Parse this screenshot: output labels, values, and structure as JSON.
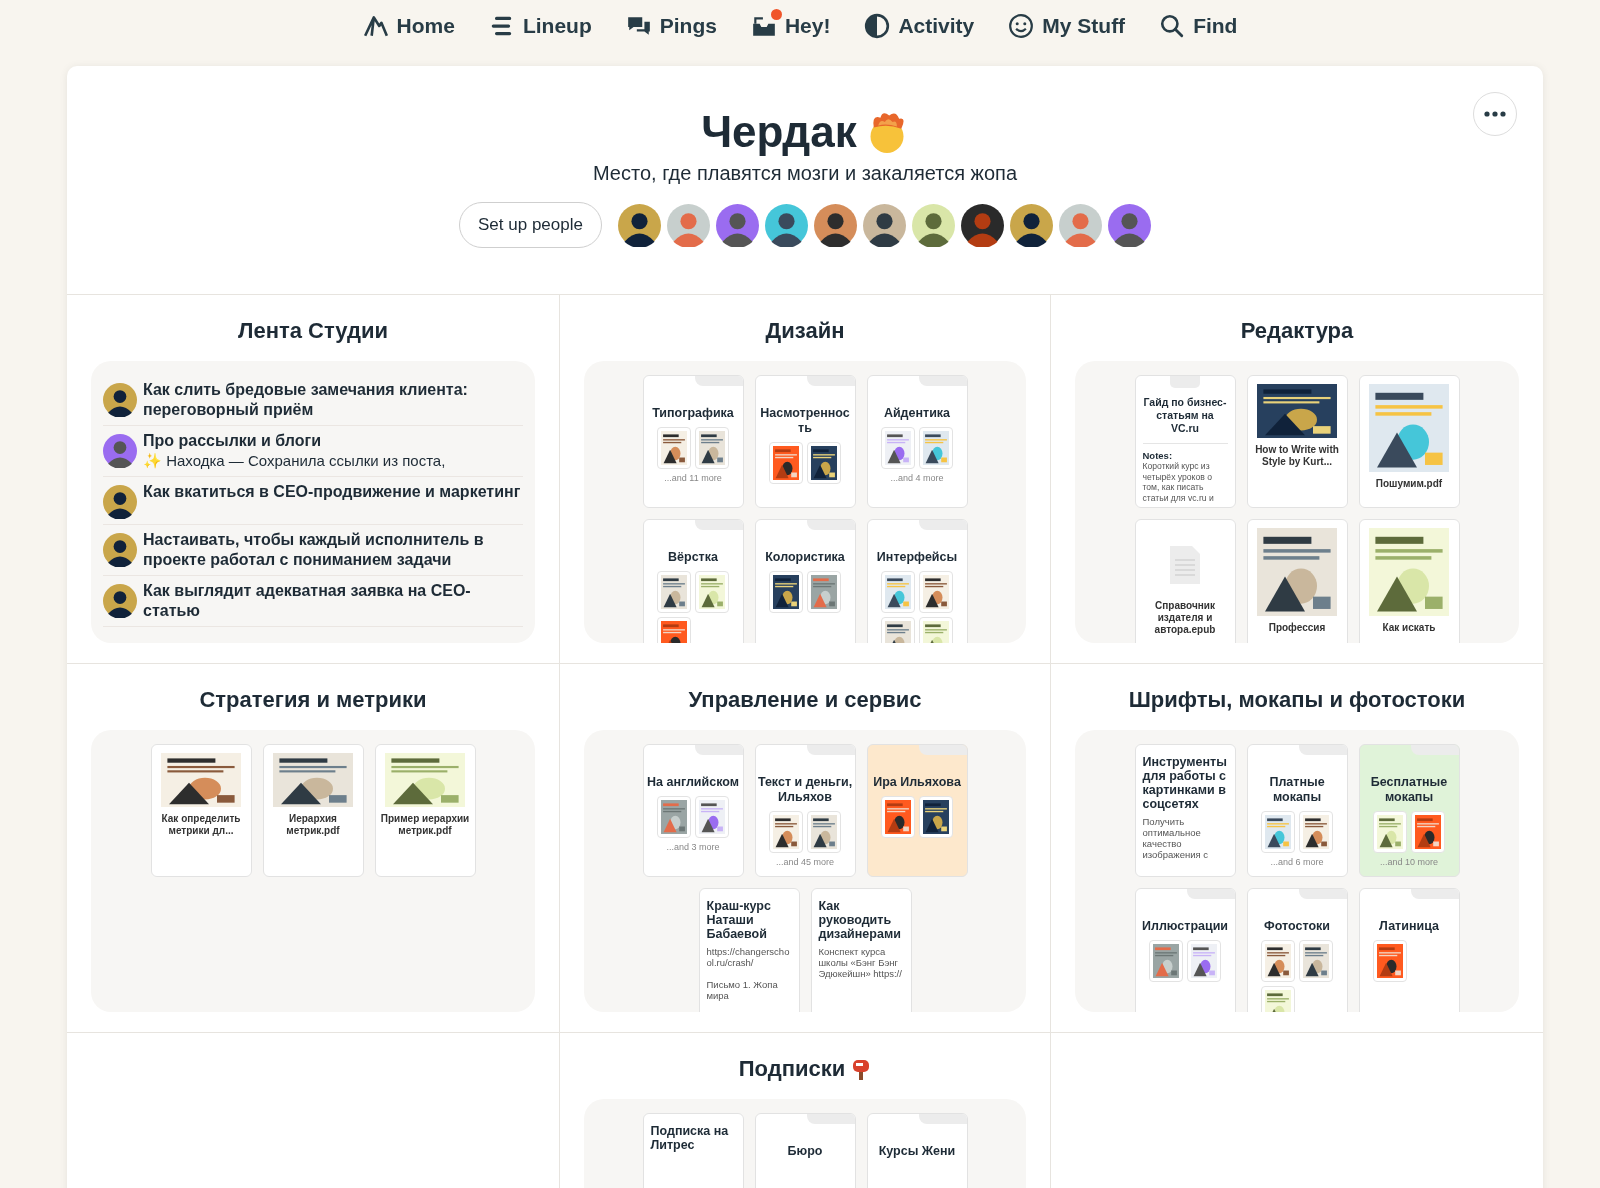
{
  "nav": [
    {
      "kind": "home",
      "label": "Home"
    },
    {
      "kind": "lineup",
      "label": "Lineup"
    },
    {
      "kind": "pings",
      "label": "Pings"
    },
    {
      "kind": "hey",
      "label": "Hey!",
      "badge": true
    },
    {
      "kind": "activity",
      "label": "Activity"
    },
    {
      "kind": "mystuff",
      "label": "My Stuff"
    },
    {
      "kind": "find",
      "label": "Find"
    }
  ],
  "project": {
    "title": "Чердак",
    "title_icon": true,
    "subtitle": "Место, где плавятся мозги и закаляется жопа",
    "people_button": "Set up people"
  },
  "tools": [
    {
      "kind": "messages",
      "title": "Лента Студии",
      "messages": [
        {
          "title": "Как слить бредовые замечания клиента: переговорный приём"
        },
        {
          "title": "Про рассылки и блоги",
          "excerpt": "✨ Находка — Сохранила ссылки из поста,"
        },
        {
          "title": "Как вкатиться в СЕО-продвижение и маркетинг"
        },
        {
          "title": "Настаивать, чтобы каждый исполнитель в проекте работал с пониманием задачи"
        },
        {
          "title": "Как выглядит адекватная заявка на СЕО-статью"
        }
      ]
    },
    {
      "kind": "tiles",
      "title": "Дизайн",
      "tiles": [
        {
          "kind": "folder",
          "title": "Типографика",
          "color": "#ffffff",
          "more": "...and 11 more"
        },
        {
          "kind": "folder",
          "title": "Насмотренность",
          "color": "#ffffff"
        },
        {
          "kind": "folder",
          "title": "Айдентика",
          "color": "#ffffff",
          "more": "...and 4 more"
        },
        {
          "kind": "folder",
          "title": "Вёрстка",
          "color": "#ffffff"
        },
        {
          "kind": "folder",
          "title": "Колористика",
          "color": "#ffffff"
        },
        {
          "kind": "folder",
          "title": "Интерфейсы",
          "color": "#ffffff"
        }
      ]
    },
    {
      "kind": "tiles",
      "title": "Редактура",
      "tiles": [
        {
          "kind": "note",
          "title": "Гайд по бизнес-статьям на VC.ru",
          "notes_label": "Notes:",
          "notes": "Короткий курс из четырёх уроков о том, как писать статьи для vc.ru и"
        },
        {
          "kind": "file",
          "title": "How to Write with Style by Kurt..."
        },
        {
          "kind": "file",
          "title": "Пошумим.pdf",
          "preview": {
            "kind": "cover"
          }
        },
        {
          "kind": "file",
          "title": "Справочник издателя и автора.epub",
          "preview": {
            "kind": "document"
          }
        },
        {
          "kind": "file",
          "title": "Профессия",
          "preview": {
            "kind": "cover"
          }
        },
        {
          "kind": "file",
          "title": "Как искать",
          "preview": {
            "kind": "cover"
          }
        }
      ]
    },
    {
      "kind": "tiles",
      "title": "Стратегия и метрики",
      "tiles": [
        {
          "kind": "file",
          "title": "Как определить метрики дл..."
        },
        {
          "kind": "file",
          "title": "Иерархия метрик.pdf"
        },
        {
          "kind": "file",
          "title": "Пример иерархии метрик.pdf"
        }
      ]
    },
    {
      "kind": "tiles",
      "title": "Управление и сервис",
      "tiles": [
        {
          "kind": "folder",
          "title": "На английском",
          "color": "#ffffff",
          "more": "...and 3 more"
        },
        {
          "kind": "folder",
          "title": "Текст и деньги, Ильяхов",
          "color": "#ffffff",
          "more": "...and 45 more"
        },
        {
          "kind": "folder",
          "title": "Ира Ильяхова",
          "color": "#fde8cc"
        },
        {
          "kind": "document",
          "title": "Краш-курс Наташи Бабаевой",
          "body": "https://changerschool.ru/crash/\n\nПисьмо 1. Жопа мира"
        },
        {
          "kind": "document",
          "title": "Как руководить дизайнерами",
          "body": "Конспект курса школы «Бэнг Бэнг Эдюкейшн» https://"
        }
      ]
    },
    {
      "kind": "tiles",
      "title": "Шрифты, мокапы и фотостоки",
      "tiles": [
        {
          "kind": "document",
          "title": "Инструменты для работы с картинками в соцсетях",
          "body": "Получить оптимальное качество изображения с"
        },
        {
          "kind": "folder",
          "title": "Платные мокапы",
          "color": "#ffffff",
          "more": "...and 6 more"
        },
        {
          "kind": "folder",
          "title": "Бесплатные мокапы",
          "color": "#e0f3d9",
          "more": "...and 10 more"
        },
        {
          "kind": "folder",
          "title": "Иллюстрации",
          "color": "#ffffff"
        },
        {
          "kind": "folder",
          "title": "Фотостоки",
          "color": "#ffffff"
        },
        {
          "kind": "folder",
          "title": "Латиница",
          "color": "#ffffff"
        }
      ]
    },
    {
      "kind": "empty"
    },
    {
      "kind": "tiles",
      "title": "Подписки",
      "icon": true,
      "tiles": [
        {
          "kind": "document",
          "title": "Подписка на Литрес"
        },
        {
          "kind": "folder",
          "title": "Бюро",
          "color": "#ffffff"
        },
        {
          "kind": "folder",
          "title": "Курсы Жени",
          "color": "#ffffff"
        }
      ]
    },
    {
      "kind": "empty"
    }
  ]
}
